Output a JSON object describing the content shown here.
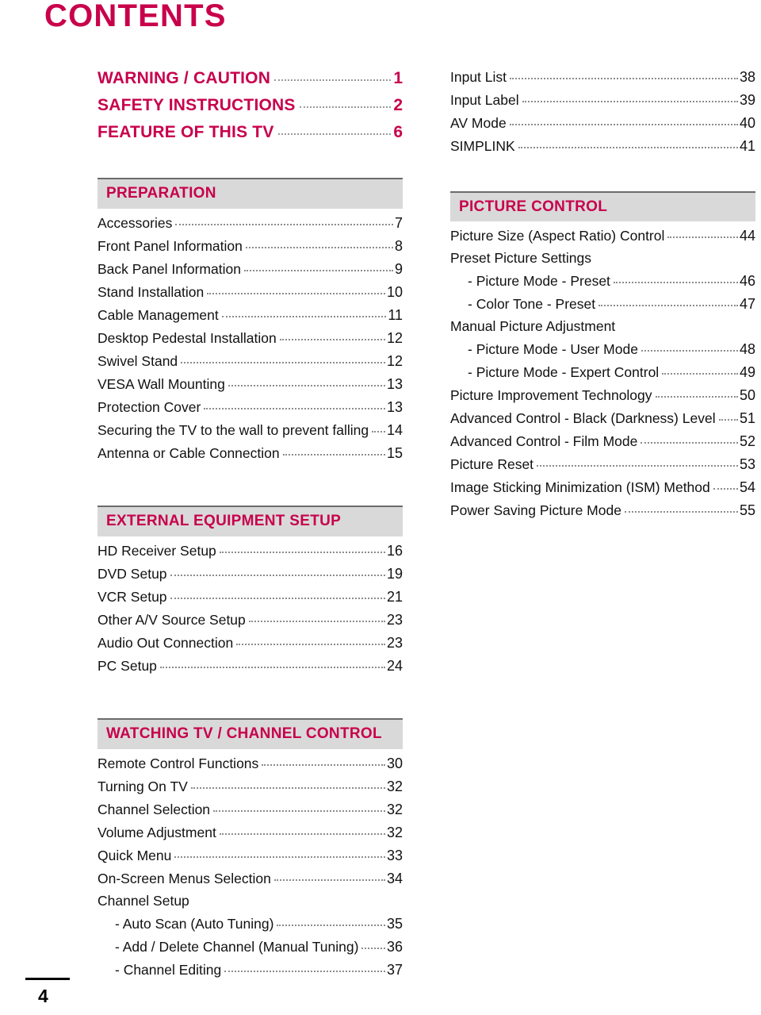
{
  "document": {
    "title": "CONTENTS",
    "page_number": "4",
    "accent_color": "#C8004B",
    "band_color": "#D9D9D9"
  },
  "left_column": {
    "top_headings": [
      {
        "label": "WARNING / CAUTION",
        "page": "1"
      },
      {
        "label": "SAFETY INSTRUCTIONS",
        "page": "2"
      },
      {
        "label": "FEATURE OF THIS TV",
        "page": "6"
      }
    ],
    "sections": [
      {
        "title": "PREPARATION",
        "entries": [
          {
            "label": "Accessories",
            "page": "7",
            "sub": false
          },
          {
            "label": "Front Panel Information",
            "page": "8",
            "sub": false
          },
          {
            "label": "Back Panel Information",
            "page": "9",
            "sub": false
          },
          {
            "label": "Stand Installation",
            "page": "10",
            "sub": false
          },
          {
            "label": "Cable Management",
            "page": "11",
            "sub": false
          },
          {
            "label": "Desktop Pedestal Installation",
            "page": "12",
            "sub": false
          },
          {
            "label": "Swivel Stand",
            "page": "12",
            "sub": false
          },
          {
            "label": "VESA Wall Mounting",
            "page": "13",
            "sub": false
          },
          {
            "label": "Protection Cover",
            "page": "13",
            "sub": false
          },
          {
            "label": "Securing the TV to the wall to prevent falling",
            "page": "14",
            "sub": false
          },
          {
            "label": "Antenna or Cable Connection",
            "page": "15",
            "sub": false
          }
        ]
      },
      {
        "title": "EXTERNAL EQUIPMENT SETUP",
        "entries": [
          {
            "label": "HD Receiver Setup",
            "page": "16",
            "sub": false
          },
          {
            "label": "DVD Setup",
            "page": "19",
            "sub": false
          },
          {
            "label": "VCR Setup",
            "page": "21",
            "sub": false
          },
          {
            "label": "Other A/V Source Setup",
            "page": "23",
            "sub": false
          },
          {
            "label": "Audio Out Connection",
            "page": "23",
            "sub": false
          },
          {
            "label": "PC Setup",
            "page": "24",
            "sub": false
          }
        ]
      },
      {
        "title": "WATCHING TV / CHANNEL CONTROL",
        "entries": [
          {
            "label": "Remote Control Functions",
            "page": "30",
            "sub": false
          },
          {
            "label": "Turning On TV",
            "page": "32",
            "sub": false
          },
          {
            "label": "Channel Selection",
            "page": "32",
            "sub": false
          },
          {
            "label": "Volume Adjustment",
            "page": "32",
            "sub": false
          },
          {
            "label": "Quick Menu",
            "page": "33",
            "sub": false
          },
          {
            "label": "On-Screen Menus Selection",
            "page": "34",
            "sub": false
          },
          {
            "label": "Channel Setup",
            "page": "",
            "sub": false,
            "noleader": true
          },
          {
            "label": "- Auto Scan (Auto Tuning)",
            "page": "35",
            "sub": true
          },
          {
            "label": "- Add / Delete Channel (Manual Tuning)",
            "page": "36",
            "sub": true
          },
          {
            "label": "- Channel Editing",
            "page": "37",
            "sub": true
          }
        ]
      }
    ]
  },
  "right_column": {
    "top_entries": [
      {
        "label": "Input List",
        "page": "38",
        "sub": false
      },
      {
        "label": "Input Label",
        "page": "39",
        "sub": false
      },
      {
        "label": "AV Mode",
        "page": "40",
        "sub": false
      },
      {
        "label": "SIMPLINK",
        "page": "41",
        "sub": false
      }
    ],
    "sections": [
      {
        "title": "PICTURE CONTROL",
        "entries": [
          {
            "label": "Picture Size (Aspect Ratio) Control",
            "page": "44",
            "sub": false
          },
          {
            "label": "Preset Picture Settings",
            "page": "",
            "sub": false,
            "noleader": true
          },
          {
            "label": "- Picture Mode - Preset",
            "page": "46",
            "sub": true
          },
          {
            "label": "- Color Tone - Preset",
            "page": "47",
            "sub": true
          },
          {
            "label": "Manual Picture Adjustment",
            "page": "",
            "sub": false,
            "noleader": true
          },
          {
            "label": "- Picture Mode - User Mode",
            "page": "48",
            "sub": true
          },
          {
            "label": "- Picture Mode - Expert Control",
            "page": "49",
            "sub": true
          },
          {
            "label": "Picture Improvement Technology",
            "page": "50",
            "sub": false
          },
          {
            "label": "Advanced Control - Black (Darkness) Level",
            "page": "51",
            "sub": false
          },
          {
            "label": "Advanced Control - Film Mode",
            "page": "52",
            "sub": false
          },
          {
            "label": "Picture Reset",
            "page": "53",
            "sub": false
          },
          {
            "label": "Image Sticking Minimization (ISM) Method",
            "page": "54",
            "sub": false
          },
          {
            "label": "Power Saving Picture Mode",
            "page": "55",
            "sub": false
          }
        ]
      }
    ]
  }
}
